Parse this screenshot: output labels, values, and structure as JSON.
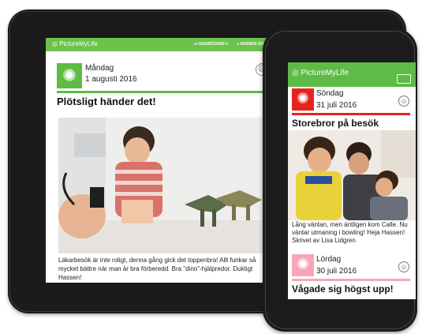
{
  "tablet": {
    "app_logo": "PictureMyLife",
    "nav": {
      "diaries": "DAGBÖCKER ▾",
      "user": "HASSEN OHAMAD ▾"
    },
    "entry": {
      "day": "Måndag",
      "date": "1 augusti 2016",
      "title": "Plötsligt händer det!",
      "caption": "Läkarbesök är inte roligt, denna gång gick det toppenbra! Allt funkar så mycket bättre när man är bra förberedd. Bra \"dino\"-hjälpredor. Duktigt Hassen!",
      "icon": "sun-icon",
      "smiley": "neutral-face-icon",
      "accent": "#5dbb46"
    }
  },
  "phone": {
    "app_logo": "PictureMyLife",
    "entries": [
      {
        "day": "Söndag",
        "date": "31 juli 2016",
        "title": "Storebror på besök",
        "caption": "Lång väntan, men äntligen kom Calle. Nu väntar utmaning i bowling! Heja Hassen!",
        "author": "Skrivet av Lisa Lidgren",
        "icon": "sun-icon",
        "smiley": "smiley-icon",
        "accent": "#e8221f"
      },
      {
        "day": "Lördag",
        "date": "30 juli 2016",
        "title": "Vågade sig högst upp!",
        "icon": "sun-icon",
        "smiley": "smiley-icon",
        "accent": "#f6a6b8"
      }
    ]
  },
  "colors": {
    "brand_green": "#6cc24a",
    "device_black": "#1c1c1c"
  }
}
